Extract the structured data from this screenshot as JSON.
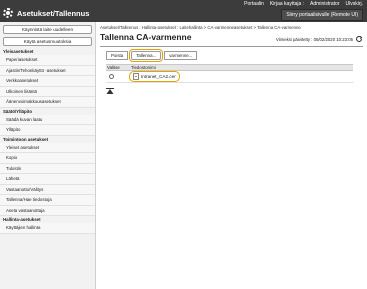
{
  "header": {
    "title": "Asetukset/Tallennus",
    "links": [
      "Portaalin",
      "Kirjaa kayttaja :",
      "Administrator",
      "Ulvskirj."
    ],
    "portal_button": "Siirry portaalisivulle (Remote UI)"
  },
  "sidebar": {
    "buttons": [
      "Käynnistä laite uudelleen",
      "Käytä asetusmuutoksia"
    ],
    "groups": [
      {
        "title": "Yleisasetukset",
        "items": [
          "Paperiasetukset",
          "Ajastin/Tehonkäyttö -asetukset",
          "Verkkoasetukset",
          "Ulkoinen liitäntä",
          "Äänenvoimakkuusasetukset"
        ]
      },
      {
        "title": "Säätö/Ylläpito",
        "items": [
          "Säädä kuvan laatu",
          "Ylläpito"
        ]
      },
      {
        "title": "Toimintoon asetukset",
        "items": [
          "Yleiset asetukset",
          "Kopio",
          "Tulostin",
          "Lähetä",
          "Vastaanotto/Välitys",
          "Tallenna/Hae tiedostoja",
          "Aseta vastaanottaja"
        ]
      },
      {
        "title": "Hallinta-asetukset",
        "items": [
          "Käyttäjien hallinta"
        ]
      }
    ]
  },
  "main": {
    "breadcrumb": "Asetukset/Tallennus : Hallinta-asetukset : Laitehallinta > CA-varmenneasetukset > Tallenna CA-varmenne",
    "title": "Tallenna CA-varmenne",
    "updated": "Viimeksi päivitetty : 05/02/2020 10:23:05 ",
    "toolbar": {
      "delete": "Poista",
      "save": "Tallenna...",
      "more": "varmenne..."
    },
    "table": {
      "headers": [
        "Valitse",
        "Tiedostonimi"
      ],
      "rows": [
        {
          "filename": "Intranet_CA2.cer"
        }
      ]
    }
  },
  "colors": {
    "highlight": "#e8a000",
    "topbar": "#3c3c3c"
  }
}
